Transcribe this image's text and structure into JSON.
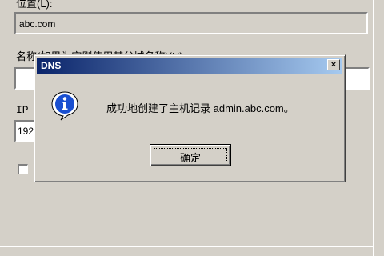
{
  "background_dialog": {
    "location_label": "位置(L):",
    "location_value": "abc.com",
    "name_label": "名称(如果为空则使用其父域名称)(N):",
    "name_value": "",
    "ip_label": "IP",
    "ip_value": "192"
  },
  "message_box": {
    "title": "DNS",
    "close_symbol": "×",
    "icon": "info-icon",
    "message": "成功地创建了主机记录 admin.abc.com。",
    "ok_label": "确定"
  }
}
